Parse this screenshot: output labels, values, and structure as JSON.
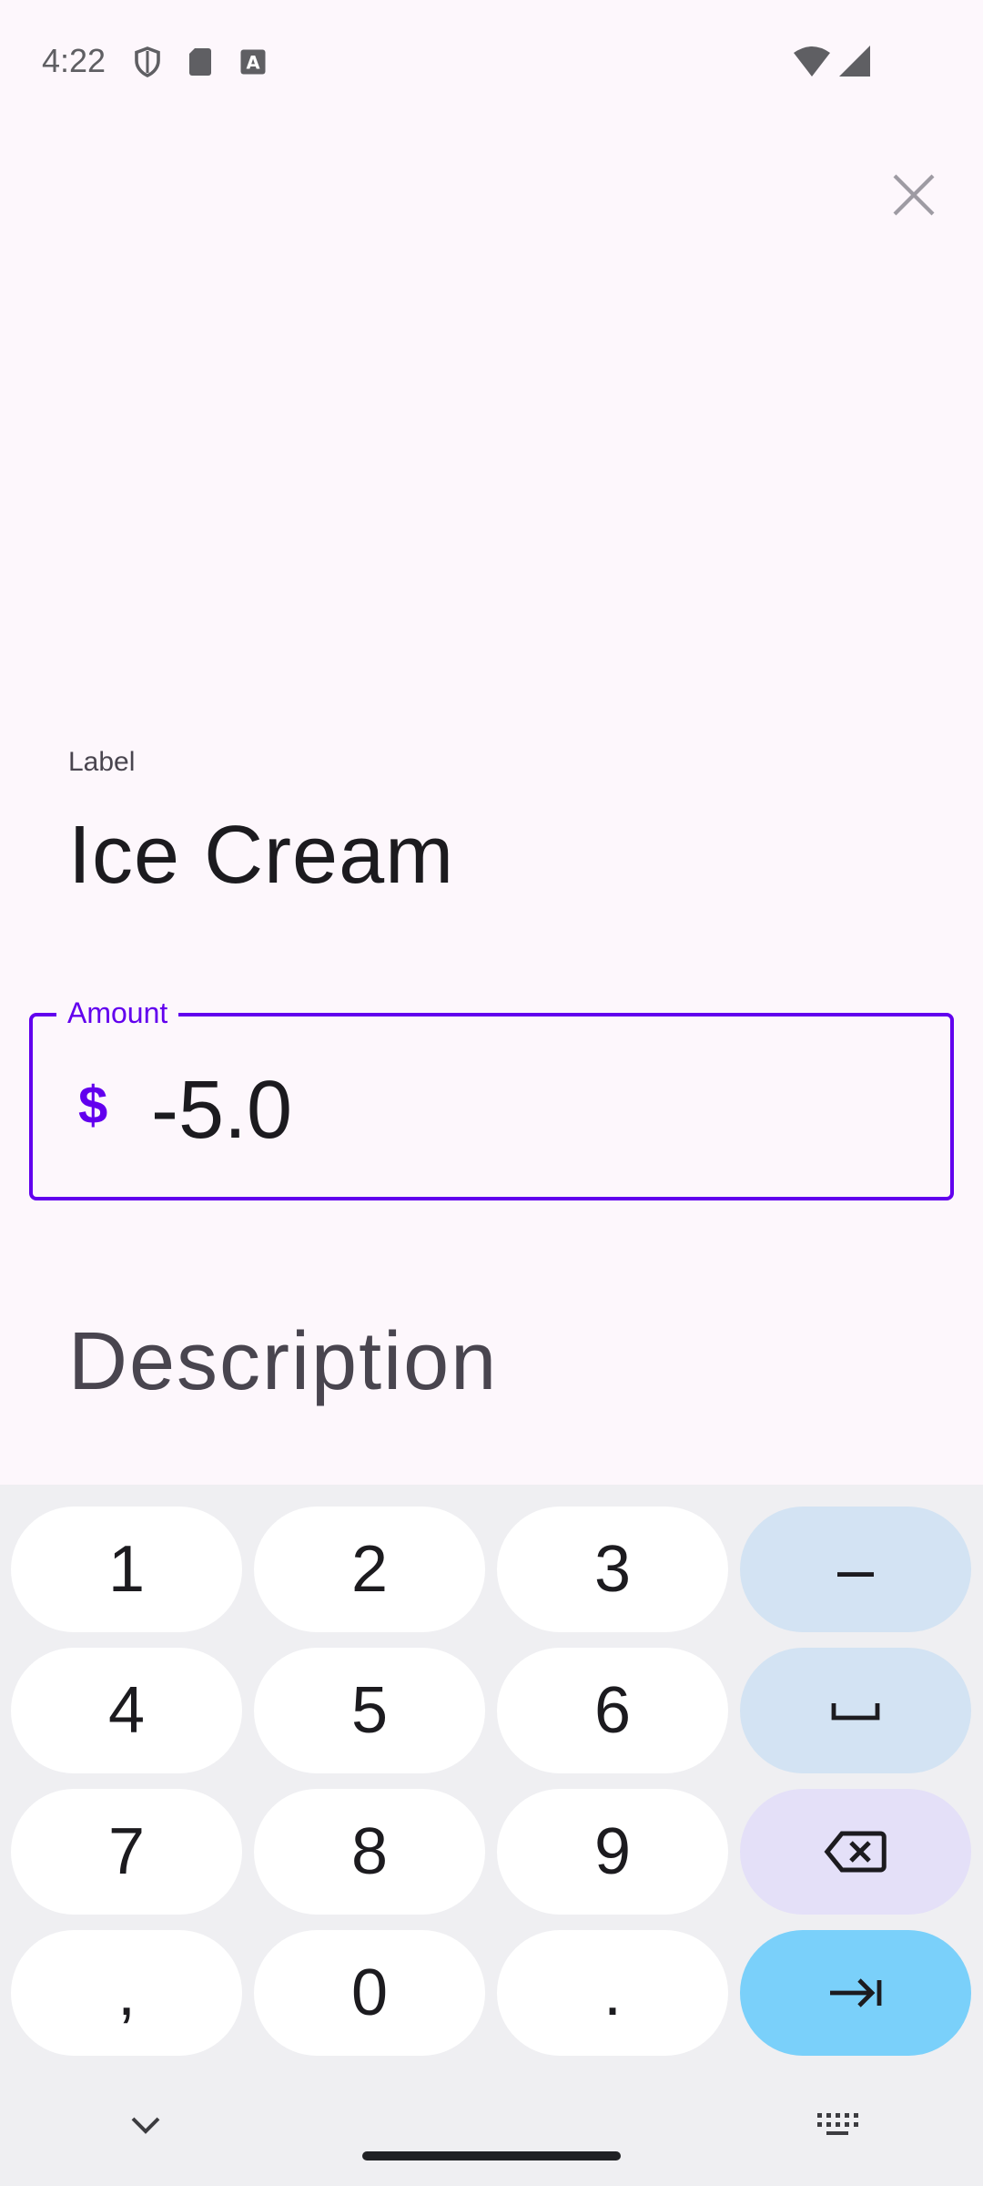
{
  "status_bar": {
    "time": "4:22",
    "icons": [
      "shield-icon",
      "sd-card-icon",
      "a-box-icon"
    ],
    "right_icons": [
      "wifi-icon",
      "signal-icon"
    ]
  },
  "header": {
    "close_icon": "close-icon"
  },
  "form": {
    "label": {
      "caption": "Label",
      "value": "Ice Cream"
    },
    "amount": {
      "legend": "Amount",
      "prefix": "$",
      "value": "-5.0"
    },
    "description": {
      "placeholder": "Description"
    }
  },
  "keyboard": {
    "rows": [
      [
        "1",
        "2",
        "3",
        "–"
      ],
      [
        "4",
        "5",
        "6",
        "space-icon"
      ],
      [
        "7",
        "8",
        "9",
        "backspace-icon"
      ],
      [
        ",",
        "0",
        ".",
        "tab-icon"
      ]
    ],
    "bottom": {
      "left_icon": "chevron-down-icon",
      "right_icon": "keyboard-icon"
    }
  },
  "colors": {
    "background": "#fdf7fc",
    "accent": "#6200ee",
    "keyboard_bg": "#efeff2",
    "key_func": "#d3e3f3",
    "key_delete": "#e4e0f8",
    "key_enter": "#7ad0fa"
  }
}
